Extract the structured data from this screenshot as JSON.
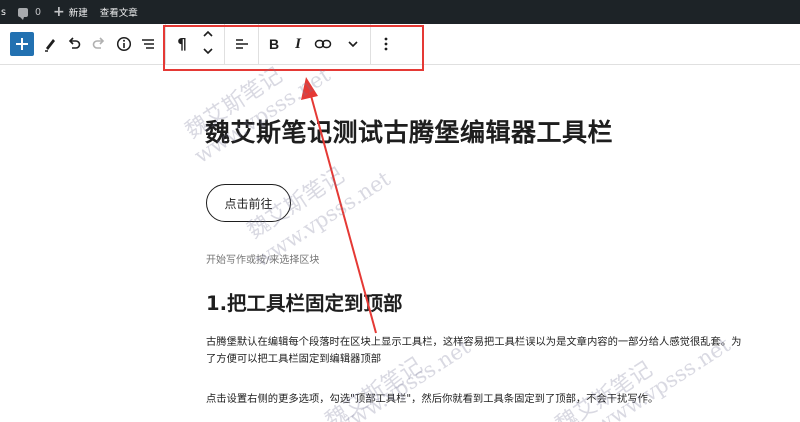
{
  "admin_bar": {
    "site_fragment": "s",
    "comments_count": "0",
    "new_label": "新建",
    "view_post_label": "查看文章"
  },
  "toolbar": {
    "left_tools": [
      "add-block",
      "tools-pen",
      "undo",
      "redo",
      "details-info",
      "list-view"
    ],
    "block_tools": [
      "paragraph",
      "move-up",
      "move-down",
      "align",
      "bold",
      "italic",
      "link",
      "more-rich-text",
      "options"
    ],
    "paragraph_symbol": "¶",
    "bold_symbol": "B",
    "italic_symbol": "I",
    "highlight_color": "#e53935",
    "accent_color": "#2271b1"
  },
  "content": {
    "title": "魏艾斯笔记测试古腾堡编辑器工具栏",
    "button_label": "点击前往",
    "placeholder": "开始写作或按/来选择区块",
    "heading": "1.把工具栏固定到顶部",
    "paragraph1_line1": "古腾堡默认在编辑每个段落时在区块上显示工具栏，这样容易把工具栏误以为是文章内容的一部分给人感觉很乱套。为",
    "paragraph1_line2": "了方便可以把工具栏固定到编辑器顶部",
    "paragraph2": "点击设置右侧的更多选项，勾选\"顶部工具栏\"，然后你就看到工具条固定到了顶部，不会干扰写作。"
  },
  "watermark": {
    "cn": "魏艾斯笔记",
    "url": "www.vpsss.net"
  }
}
